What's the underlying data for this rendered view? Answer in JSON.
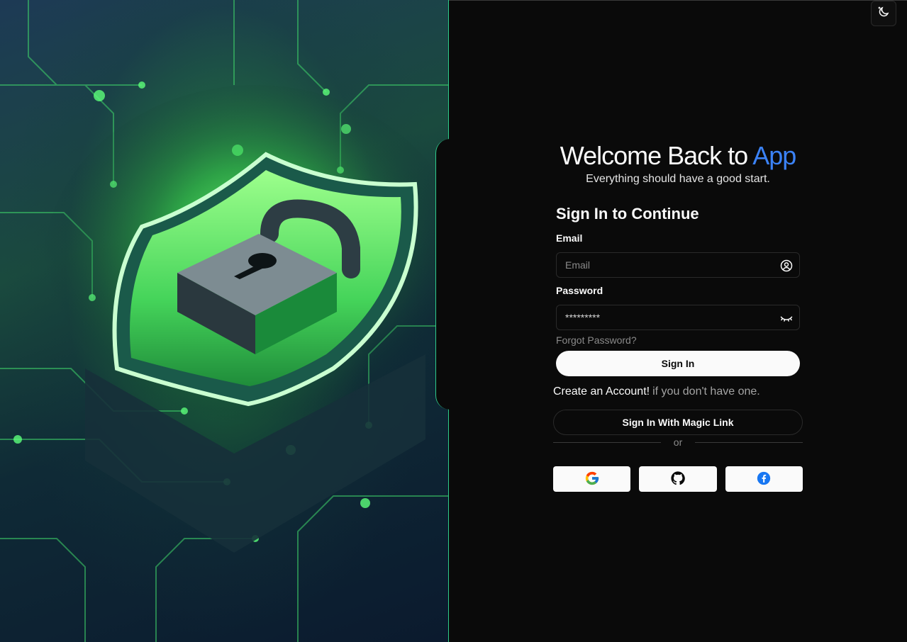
{
  "welcome": {
    "title_prefix": "Welcome Back to",
    "title_accent": "App",
    "subtitle": "Everything should have a good start."
  },
  "form": {
    "heading": "Sign In to Continue",
    "email_label": "Email",
    "email_placeholder": "Email",
    "password_label": "Password",
    "password_value": "*********",
    "forgot_link": "Forgot Password?",
    "submit_label": "Sign In"
  },
  "signup": {
    "link": "Create an Account!",
    "rest": "if you don't have one."
  },
  "magic_link_label": "Sign In With Magic Link",
  "divider_text": "or",
  "social": [
    {
      "icon": "google-icon"
    },
    {
      "icon": "github-icon"
    },
    {
      "icon": "facebook-icon"
    }
  ],
  "icons": {
    "theme_toggle": "moon-stars-icon",
    "email": "user-circle-icon",
    "password": "eye-closed-icon"
  },
  "colors": {
    "accent": "#3b82f6",
    "background": "#0a0a0a",
    "hero_glow": "#4cff5a",
    "panel_border": "#2ecc8b"
  }
}
